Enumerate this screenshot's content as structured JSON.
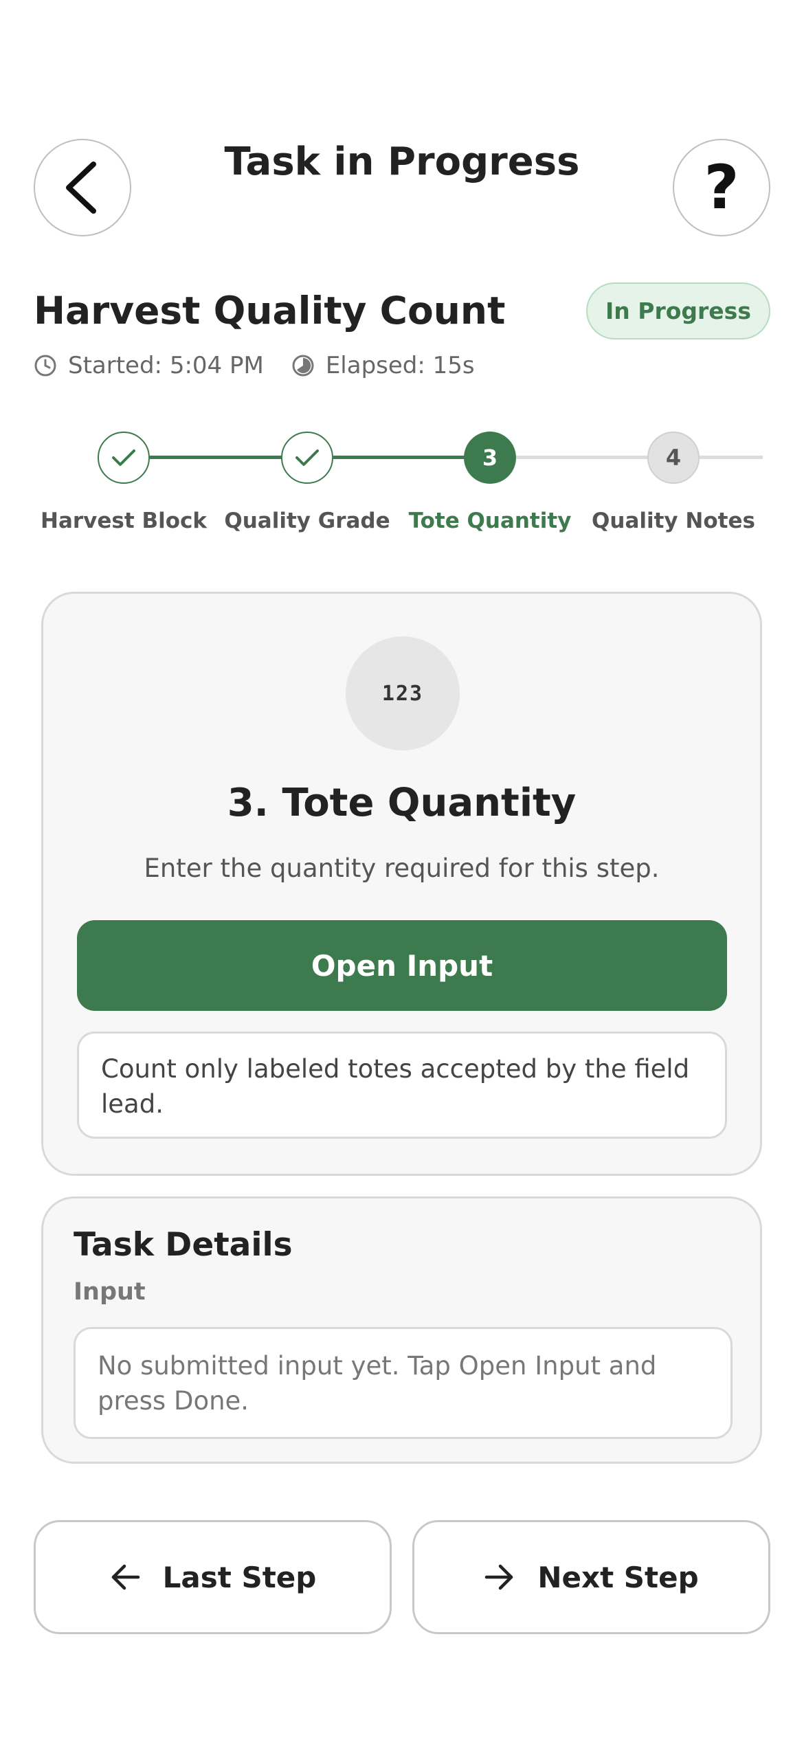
{
  "header": {
    "title": "Task in Progress",
    "help_label": "?"
  },
  "task": {
    "title": "Harvest Quality Count",
    "status": "In Progress",
    "started": "Started: 5:04 PM",
    "elapsed": "Elapsed: 15s"
  },
  "stepper": {
    "steps": [
      {
        "label": "Harvest Block",
        "state": "done",
        "number": "1"
      },
      {
        "label": "Quality Grade",
        "state": "done",
        "number": "2"
      },
      {
        "label": "Tote Quantity",
        "state": "active",
        "number": "3"
      },
      {
        "label": "Quality Notes",
        "state": "todo",
        "number": "4"
      }
    ]
  },
  "current_step": {
    "icon_text": "123",
    "title": "3. Tote Quantity",
    "description": "Enter the quantity required for this step.",
    "open_input_label": "Open Input",
    "note": "Count only labeled totes accepted by the field lead."
  },
  "details": {
    "title": "Task Details",
    "input_label": "Input",
    "input_value": "No submitted input yet. Tap Open Input and press Done."
  },
  "nav": {
    "prev_label": "Last Step",
    "next_label": "Next Step"
  },
  "colors": {
    "accent": "#3d7a4d",
    "badge_bg": "#e6f3e8",
    "card_bg": "#f7f7f7",
    "border": "#d9d9d9"
  }
}
